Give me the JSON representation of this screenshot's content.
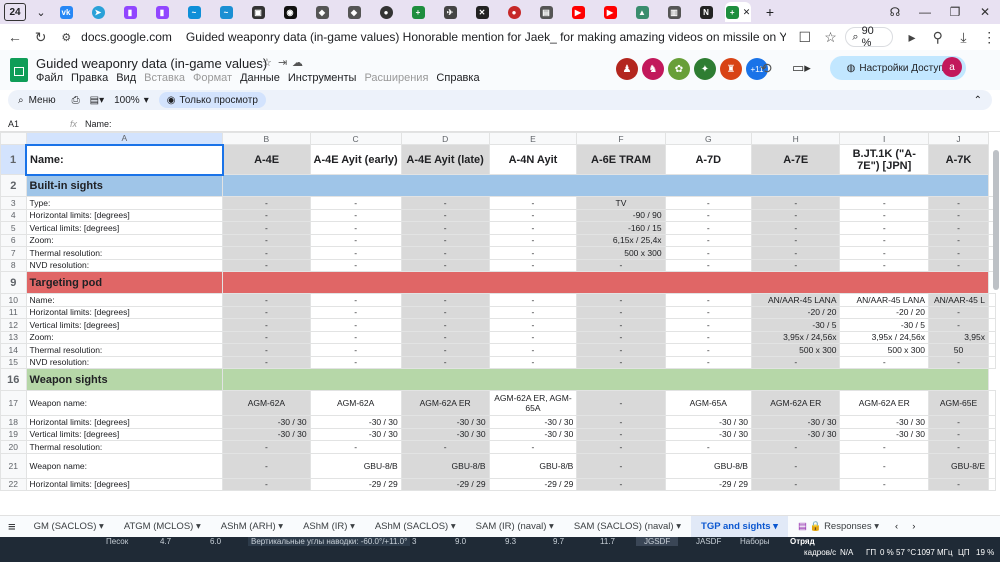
{
  "browser": {
    "tab_count": "24",
    "url": "docs.google.com",
    "page_title": "Guided weaponry data (in-game values) Honorable mention for Jaek_ for making amazing videos on missile on YouTube If you...",
    "zoom": "90 %"
  },
  "sheet": {
    "title": "Guided weaponry data (in-game values)",
    "menus": [
      "Файл",
      "Правка",
      "Вид",
      "Вставка",
      "Формат",
      "Данные",
      "Инструменты",
      "Расширения",
      "Справка"
    ],
    "collab_extra": "+11",
    "share_label": "Настройки Доступа",
    "user_initial": "a"
  },
  "toolbar": {
    "menu_label": "Меню",
    "zoom": "100%",
    "view_only": "Только просмотр"
  },
  "formula": {
    "cell_ref": "A1",
    "fx": "fx",
    "content": "Name:"
  },
  "columns": [
    "A",
    "B",
    "C",
    "D",
    "E",
    "F",
    "G",
    "H",
    "I",
    "J"
  ],
  "row_numbers": [
    "1",
    "2",
    "3",
    "4",
    "5",
    "6",
    "7",
    "8",
    "9",
    "10",
    "11",
    "12",
    "13",
    "14",
    "15",
    "16",
    "17",
    "18",
    "19",
    "20",
    "21",
    "22"
  ],
  "header_row": {
    "name": "Name:",
    "cells": [
      "A-4E",
      "A-4E Ayit (early)",
      "A-4E Ayit (late)",
      "A-4N Ayit",
      "A-6E TRAM",
      "A-7D",
      "A-7E",
      "B.JT.1K (\"A-7E\") [JPN]",
      "A-7K"
    ]
  },
  "sections": {
    "builtin": "Built-in sights",
    "pod": "Targeting pod",
    "weapon": "Weapon sights"
  },
  "rows": [
    {
      "label": "Type:",
      "cells": [
        "-",
        "-",
        "-",
        "-",
        "TV",
        "-",
        "-",
        "-",
        "-"
      ]
    },
    {
      "label": "Horizontal limits: [degrees]",
      "cells": [
        "-",
        "-",
        "-",
        "-",
        "-90 / 90",
        "-",
        "-",
        "-",
        "-"
      ]
    },
    {
      "label": "Vertical limits: [degrees]",
      "cells": [
        "-",
        "-",
        "-",
        "-",
        "-160 / 15",
        "-",
        "-",
        "-",
        "-"
      ]
    },
    {
      "label": "Zoom:",
      "cells": [
        "-",
        "-",
        "-",
        "-",
        "6,15x / 25,4x",
        "-",
        "-",
        "-",
        "-"
      ]
    },
    {
      "label": "Thermal resolution:",
      "cells": [
        "-",
        "-",
        "-",
        "-",
        "500 x 300",
        "-",
        "-",
        "-",
        "-"
      ]
    },
    {
      "label": "NVD resolution:",
      "cells": [
        "-",
        "-",
        "-",
        "-",
        "-",
        "-",
        "-",
        "-",
        "-"
      ]
    },
    {
      "label": "Name:",
      "cells": [
        "-",
        "-",
        "-",
        "-",
        "-",
        "-",
        "AN/AAR-45 LANA",
        "AN/AAR-45 LANA",
        "AN/AAR-45 L"
      ]
    },
    {
      "label": "Horizontal limits: [degrees]",
      "cells": [
        "-",
        "-",
        "-",
        "-",
        "-",
        "-",
        "-20 / 20",
        "-20 / 20",
        "-"
      ]
    },
    {
      "label": "Vertical limits: [degrees]",
      "cells": [
        "-",
        "-",
        "-",
        "-",
        "-",
        "-",
        "-30 / 5",
        "-30 / 5",
        "-"
      ]
    },
    {
      "label": "Zoom:",
      "cells": [
        "-",
        "-",
        "-",
        "-",
        "-",
        "-",
        "3,95x / 24,56x",
        "3,95x / 24,56x",
        "3,95x"
      ]
    },
    {
      "label": "Thermal resolution:",
      "cells": [
        "-",
        "-",
        "-",
        "-",
        "-",
        "-",
        "500 x 300",
        "500 x 300",
        "50"
      ]
    },
    {
      "label": "NVD resolution:",
      "cells": [
        "-",
        "-",
        "-",
        "-",
        "-",
        "-",
        "-",
        "-",
        "-"
      ]
    },
    {
      "label": "Weapon name:",
      "cells": [
        "AGM-62A",
        "AGM-62A",
        "AGM-62A ER",
        "AGM-62A ER, AGM-65A",
        "-",
        "AGM-65A",
        "AGM-62A ER",
        "AGM-62A ER",
        "AGM-65E"
      ]
    },
    {
      "label": "Horizontal limits: [degrees]",
      "cells": [
        "-30 / 30",
        "-30 / 30",
        "-30 / 30",
        "-30 / 30",
        "-",
        "-30 / 30",
        "-30 / 30",
        "-30 / 30",
        "-"
      ]
    },
    {
      "label": "Vertical limits: [degrees]",
      "cells": [
        "-30 / 30",
        "-30 / 30",
        "-30 / 30",
        "-30 / 30",
        "-",
        "-30 / 30",
        "-30 / 30",
        "-30 / 30",
        "-"
      ]
    },
    {
      "label": "Thermal resolution:",
      "cells": [
        "-",
        "-",
        "-",
        "-",
        "-",
        "-",
        "-",
        "-",
        "-"
      ]
    },
    {
      "label": "Weapon name:",
      "cells": [
        "-",
        "GBU-8/B",
        "GBU-8/B",
        "GBU-8/B",
        "-",
        "GBU-8/B",
        "-",
        "-",
        "GBU-8/E"
      ]
    },
    {
      "label": "Horizontal limits: [degrees]",
      "cells": [
        "-",
        "-29 / 29",
        "-29 / 29",
        "-29 / 29",
        "-",
        "-29 / 29",
        "-",
        "-",
        "-"
      ]
    }
  ],
  "sheet_tabs": [
    "GM (SACLOS)",
    "ATGM (MCLOS)",
    "AShM (ARH)",
    "AShM (IR)",
    "AShM (SACLOS)",
    "SAM (IR) (naval)",
    "SAM (SACLOS) (naval)",
    "TGP and sights",
    "Responses"
  ],
  "active_tab": "TGP and sights",
  "taskbar": {
    "items": [
      "Песок",
      "4.7",
      "6.0",
      "Вертикальные углы наводки: -60.0°/+11.0°",
      "3",
      "9.0",
      "9.3",
      "9.7",
      "11.7",
      "JGSDF",
      "JASDF",
      "Наборы",
      "Отряд"
    ],
    "speed": "кадров/с",
    "na": "N/A",
    "gpu": "ГП",
    "gpu_val": "0 %",
    "temp": "57 °C",
    "freq": "1097 МГц",
    "cpu": "ЦП",
    "cpu_val": "19 %"
  },
  "colors": {
    "builtin": "#9fc5e8",
    "pod": "#e06666",
    "weapon": "#b6d7a8",
    "accent": "#0b57d0"
  }
}
